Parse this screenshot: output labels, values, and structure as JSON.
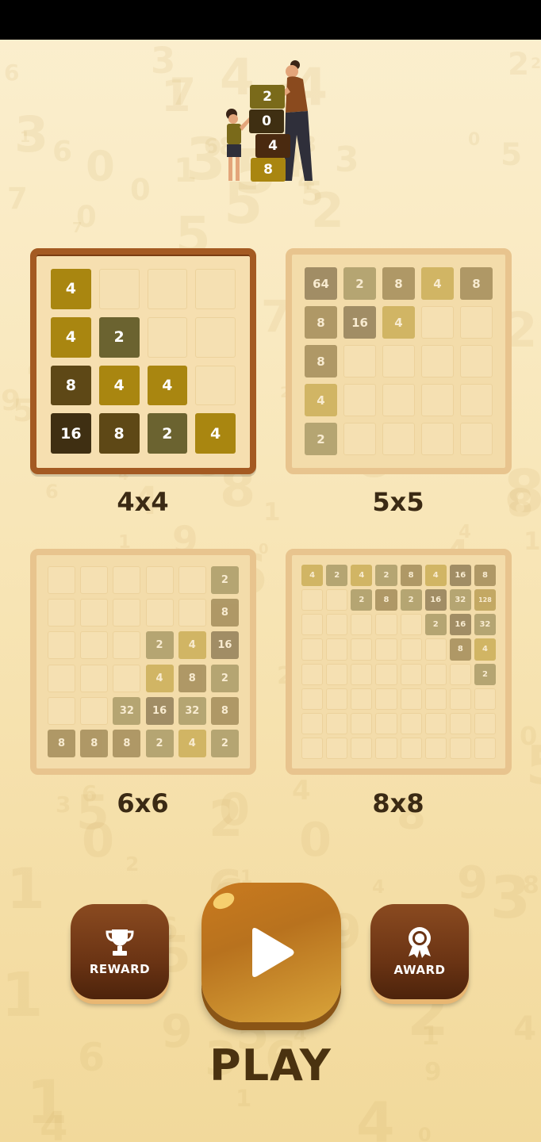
{
  "colors": {
    "tile_brown_dark": "#3f2f12",
    "tile_brown": "#5e4816",
    "tile_gold": "#8a6a0e",
    "tile_gold_bright": "#a98610",
    "tile_gray": "#6b6330",
    "selected_border": "#a45a22",
    "button_brown": "#6b3414",
    "play_gold": "#c97a1f"
  },
  "hero": {
    "icon": "mother-child-stacking-blocks-illustration",
    "blocks": [
      "2",
      "0",
      "4",
      "8"
    ]
  },
  "boards": [
    {
      "id": "4x4",
      "label": "4x4",
      "selected": true,
      "size": 4,
      "tiles": [
        [
          "4",
          "",
          "",
          ""
        ],
        [
          "4",
          "2",
          "",
          ""
        ],
        [
          "8",
          "4",
          "4",
          ""
        ],
        [
          "16",
          "8",
          "2",
          "4"
        ]
      ]
    },
    {
      "id": "5x5",
      "label": "5x5",
      "selected": false,
      "size": 5,
      "tiles": [
        [
          "64",
          "2",
          "8",
          "4",
          "8"
        ],
        [
          "8",
          "16",
          "4",
          "",
          ""
        ],
        [
          "8",
          "",
          "",
          "",
          ""
        ],
        [
          "4",
          "",
          "",
          "",
          ""
        ],
        [
          "2",
          "",
          "",
          "",
          ""
        ]
      ]
    },
    {
      "id": "6x6",
      "label": "6x6",
      "selected": false,
      "size": 6,
      "tiles": [
        [
          "",
          "",
          "",
          "",
          "",
          "2"
        ],
        [
          "",
          "",
          "",
          "",
          "",
          "8"
        ],
        [
          "",
          "",
          "",
          "2",
          "4",
          "16"
        ],
        [
          "",
          "",
          "",
          "4",
          "8",
          "2"
        ],
        [
          "",
          "",
          "32",
          "16",
          "32",
          "8"
        ],
        [
          "8",
          "8",
          "8",
          "2",
          "4",
          "2"
        ]
      ]
    },
    {
      "id": "8x8",
      "label": "8x8",
      "selected": false,
      "size": 8,
      "tiles": [
        [
          "4",
          "2",
          "4",
          "2",
          "8",
          "4",
          "16",
          "8"
        ],
        [
          "",
          "",
          "2",
          "8",
          "2",
          "16",
          "32",
          "128"
        ],
        [
          "",
          "",
          "",
          "",
          "",
          "2",
          "16",
          "32"
        ],
        [
          "",
          "",
          "",
          "",
          "",
          "",
          "8",
          "4"
        ],
        [
          "",
          "",
          "",
          "",
          "",
          "",
          "",
          "2"
        ],
        [
          "",
          "",
          "",
          "",
          "",
          "",
          "",
          ""
        ],
        [
          "",
          "",
          "",
          "",
          "",
          "",
          "",
          ""
        ],
        [
          "",
          "",
          "",
          "",
          "",
          "",
          "",
          ""
        ]
      ]
    }
  ],
  "buttons": {
    "reward": {
      "label": "REWARD",
      "icon": "trophy-icon"
    },
    "award": {
      "label": "AWARD",
      "icon": "award-ribbon-icon"
    },
    "play": {
      "icon": "play-icon",
      "label": "PLAY"
    }
  }
}
